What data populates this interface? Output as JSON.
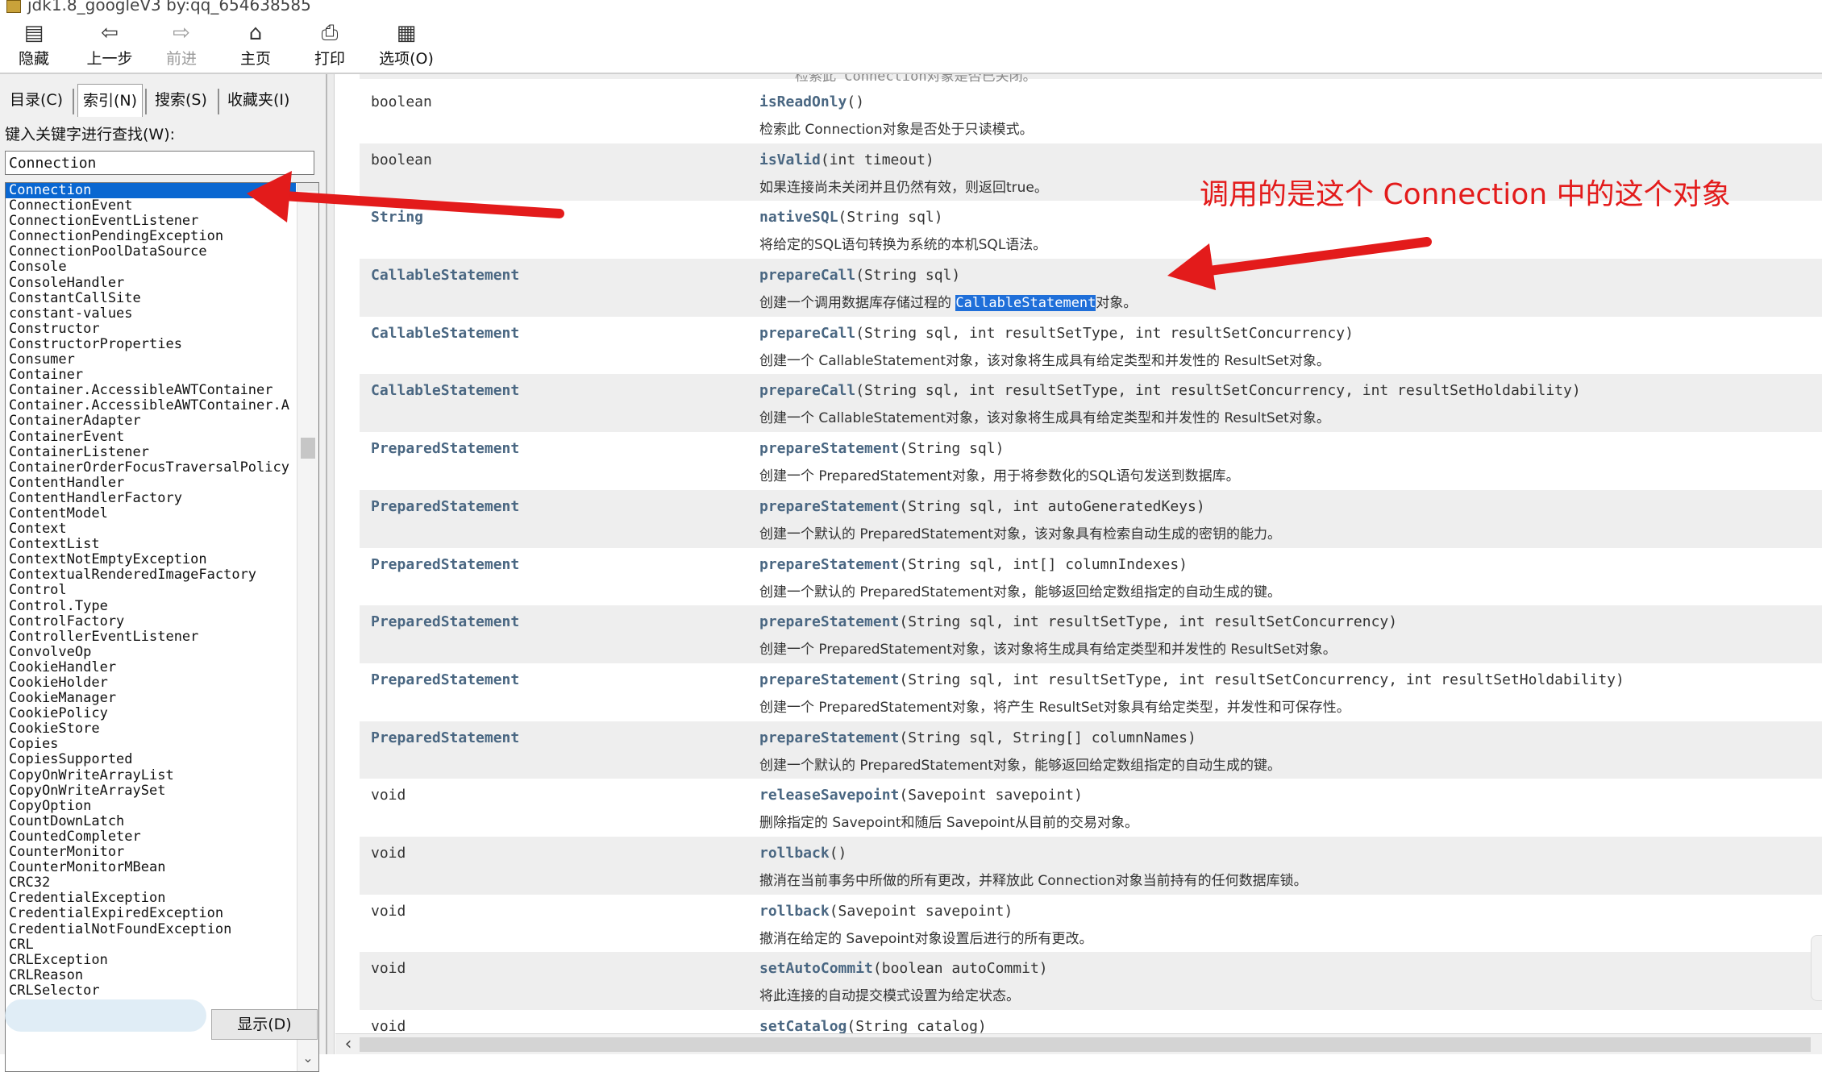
{
  "window": {
    "title": "jdk1.8_googleV3 by:qq_654638585"
  },
  "toolbar": {
    "buttons": [
      {
        "label": "隐藏",
        "icon": "hide-icon",
        "glyph": "▤",
        "disabled": false
      },
      {
        "label": "上一步",
        "icon": "back-icon",
        "glyph": "⇦",
        "disabled": false
      },
      {
        "label": "前进",
        "icon": "forward-icon",
        "glyph": "⇨",
        "disabled": true
      },
      {
        "label": "主页",
        "icon": "home-icon",
        "glyph": "⌂",
        "disabled": false
      },
      {
        "label": "打印",
        "icon": "print-icon",
        "glyph": "⎙",
        "disabled": false
      },
      {
        "label": "选项(O)",
        "icon": "options-icon",
        "glyph": "▦",
        "disabled": false
      }
    ]
  },
  "left": {
    "tabs": [
      {
        "label": "目录(C)",
        "active": false
      },
      {
        "label": "索引(N)",
        "active": true
      },
      {
        "label": "搜索(S)",
        "active": false
      },
      {
        "label": "收藏夹(I)",
        "active": false
      }
    ],
    "keyword_label": "键入关键字进行查找(W):",
    "search_value": "Connection",
    "show_button": "显示(D)",
    "index_items": [
      "Connection",
      "ConnectionEvent",
      "ConnectionEventListener",
      "ConnectionPendingException",
      "ConnectionPoolDataSource",
      "Console",
      "ConsoleHandler",
      "ConstantCallSite",
      "constant-values",
      "Constructor",
      "ConstructorProperties",
      "Consumer",
      "Container",
      "Container.AccessibleAWTContainer",
      "Container.AccessibleAWTContainer.A",
      "ContainerAdapter",
      "ContainerEvent",
      "ContainerListener",
      "ContainerOrderFocusTraversalPolicy",
      "ContentHandler",
      "ContentHandlerFactory",
      "ContentModel",
      "Context",
      "ContextList",
      "ContextNotEmptyException",
      "ContextualRenderedImageFactory",
      "Control",
      "Control.Type",
      "ControlFactory",
      "ControllerEventListener",
      "ConvolveOp",
      "CookieHandler",
      "CookieHolder",
      "CookieManager",
      "CookiePolicy",
      "CookieStore",
      "Copies",
      "CopiesSupported",
      "CopyOnWriteArrayList",
      "CopyOnWriteArraySet",
      "CopyOption",
      "CountDownLatch",
      "CountedCompleter",
      "CounterMonitor",
      "CounterMonitorMBean",
      "CRC32",
      "CredentialException",
      "CredentialExpiredException",
      "CredentialNotFoundException",
      "CRL",
      "CRLException",
      "CRLReason",
      "CRLSelector"
    ],
    "selected_index": 0
  },
  "content": {
    "top_cut_text": "检索此 Connection对象是否已关闭。",
    "rows": [
      {
        "type": "boolean",
        "type_link": false,
        "method": "isReadOnly",
        "params": "()",
        "desc": "检索此 Connection对象是否处于只读模式。"
      },
      {
        "type": "boolean",
        "type_link": false,
        "method": "isValid",
        "params": "(int timeout)",
        "method_link": false,
        "desc": "如果连接尚未关闭并且仍然有效，则返回true。"
      },
      {
        "type": "String",
        "type_link": true,
        "method": "nativeSQL",
        "params": "(String sql)",
        "desc": "将给定的SQL语句转换为系统的本机SQL语法。"
      },
      {
        "type": "CallableStatement",
        "type_link": true,
        "method": "prepareCall",
        "params": "(String sql)",
        "desc_pre": "创建一个调用数据库存储过程的 ",
        "desc_hl": "CallableStatement",
        "desc_post": "对象。"
      },
      {
        "type": "CallableStatement",
        "type_link": true,
        "method": "prepareCall",
        "params": "(String sql, int resultSetType, int resultSetConcurrency)",
        "desc": "创建一个 CallableStatement对象，该对象将生成具有给定类型和并发性的 ResultSet对象。"
      },
      {
        "type": "CallableStatement",
        "type_link": true,
        "method": "prepareCall",
        "params": "(String sql, int resultSetType, int resultSetConcurrency, int resultSetHoldability)",
        "desc": "创建一个 CallableStatement对象，该对象将生成具有给定类型和并发性的 ResultSet对象。"
      },
      {
        "type": "PreparedStatement",
        "type_link": true,
        "method": "prepareStatement",
        "params": "(String sql)",
        "desc": "创建一个 PreparedStatement对象，用于将参数化的SQL语句发送到数据库。"
      },
      {
        "type": "PreparedStatement",
        "type_link": true,
        "method": "prepareStatement",
        "params": "(String sql, int autoGeneratedKeys)",
        "desc": "创建一个默认的 PreparedStatement对象，该对象具有检索自动生成的密钥的能力。"
      },
      {
        "type": "PreparedStatement",
        "type_link": true,
        "method": "prepareStatement",
        "params": "(String sql, int[] columnIndexes)",
        "desc": "创建一个默认的 PreparedStatement对象，能够返回给定数组指定的自动生成的键。"
      },
      {
        "type": "PreparedStatement",
        "type_link": true,
        "method": "prepareStatement",
        "params": "(String sql, int resultSetType, int resultSetConcurrency)",
        "desc": "创建一个 PreparedStatement对象，该对象将生成具有给定类型和并发性的 ResultSet对象。"
      },
      {
        "type": "PreparedStatement",
        "type_link": true,
        "method": "prepareStatement",
        "params": "(String sql, int resultSetType, int resultSetConcurrency, int resultSetHoldability)",
        "desc": "创建一个 PreparedStatement对象，将产生 ResultSet对象具有给定类型，并发性和可保存性。"
      },
      {
        "type": "PreparedStatement",
        "type_link": true,
        "method": "prepareStatement",
        "params": "(String sql, String[] columnNames)",
        "desc": "创建一个默认的 PreparedStatement对象，能够返回给定数组指定的自动生成的键。"
      },
      {
        "type": "void",
        "type_link": false,
        "method": "releaseSavepoint",
        "params": "(Savepoint savepoint)",
        "desc": "删除指定的 Savepoint和随后 Savepoint从目前的交易对象。"
      },
      {
        "type": "void",
        "type_link": false,
        "method": "rollback",
        "params": "()",
        "desc": "撤消在当前事务中所做的所有更改，并释放此 Connection对象当前持有的任何数据库锁。"
      },
      {
        "type": "void",
        "type_link": false,
        "method": "rollback",
        "params": "(Savepoint savepoint)",
        "desc": "撤消在给定的 Savepoint对象设置后进行的所有更改。"
      },
      {
        "type": "void",
        "type_link": false,
        "method": "setAutoCommit",
        "params": "(boolean autoCommit)",
        "desc": "将此连接的自动提交模式设置为给定状态。"
      },
      {
        "type": "void",
        "type_link": false,
        "method": "setCatalog",
        "params": "(String catalog)",
        "desc": ""
      }
    ]
  },
  "annotation": {
    "text": "调用的是这个 Connection 中的这个对象",
    "color": "#e31b1b"
  },
  "colors": {
    "selection": "#0a67d1",
    "link": "#4a6782",
    "row_shade": "#eeeeee"
  }
}
